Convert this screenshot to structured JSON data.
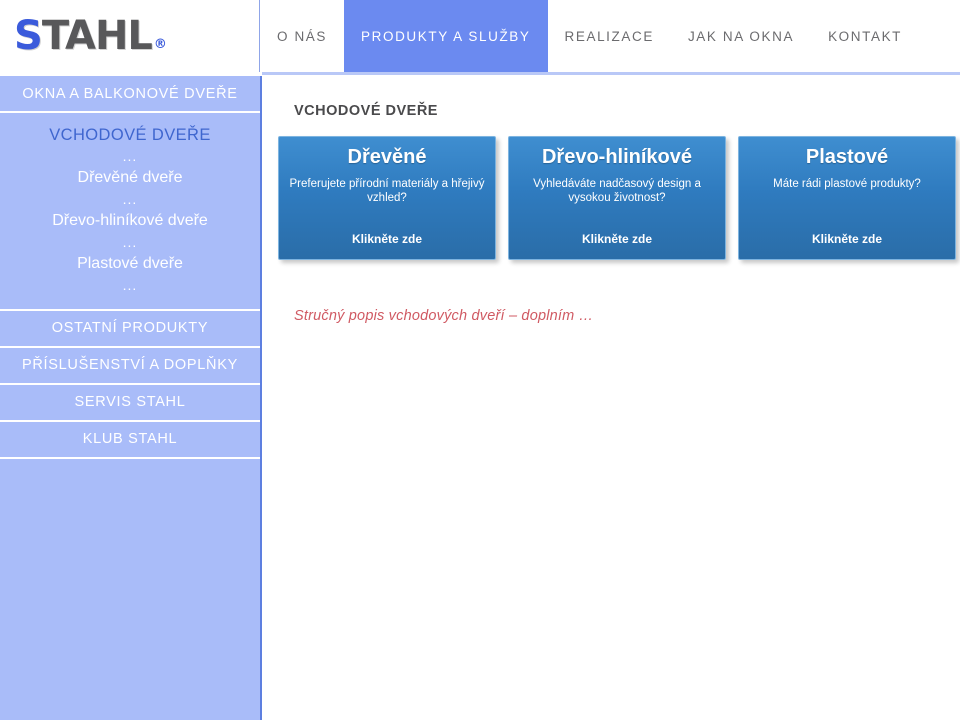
{
  "header": {
    "logo": {
      "first": "S",
      "rest": "TAHL",
      "reg": "®"
    },
    "nav": [
      {
        "label": "O NÁS",
        "active": false
      },
      {
        "label": "PRODUKTY A SLUŽBY",
        "active": true
      },
      {
        "label": "REALIZACE",
        "active": false
      },
      {
        "label": "JAK NA OKNA",
        "active": false
      },
      {
        "label": "KONTAKT",
        "active": false
      }
    ]
  },
  "sidebar": {
    "top_item": "OKNA A BALKONOVÉ DVEŘE",
    "open_group": {
      "current": "VCHODOVÉ DVEŘE",
      "dots": "...",
      "links": [
        "Dřevěné dveře",
        "Dřevo-hliníkové dveře",
        "Plastové dveře"
      ]
    },
    "items": [
      "OSTATNÍ PRODUKTY",
      "PŘÍSLUŠENSTVÍ A DOPLŇKY",
      "SERVIS STAHL",
      "KLUB STAHL"
    ]
  },
  "main": {
    "title": "VCHODOVÉ DVEŘE",
    "note": "Stručný popis vchodových dveří – doplním …",
    "cards": [
      {
        "title": "Dřevěné",
        "desc": "Preferujete přírodní materiály a hřejivý vzhled?",
        "cta": "Klikněte zde"
      },
      {
        "title": "Dřevo-hliníkové",
        "desc": "Vyhledáváte nadčasový design a  vysokou životnost?",
        "cta": "Klikněte zde"
      },
      {
        "title": "Plastové",
        "desc": "Máte rádi plastové produkty?",
        "cta": "Klikněte zde"
      }
    ]
  },
  "colors": {
    "sidebar_bg": "#a9bcf9",
    "nav_active": "#6b8af0",
    "card_blue": "#2f7bbf",
    "note_red": "#d05a63",
    "logo_blue": "#3b5bdb",
    "logo_gray": "#58585a"
  }
}
